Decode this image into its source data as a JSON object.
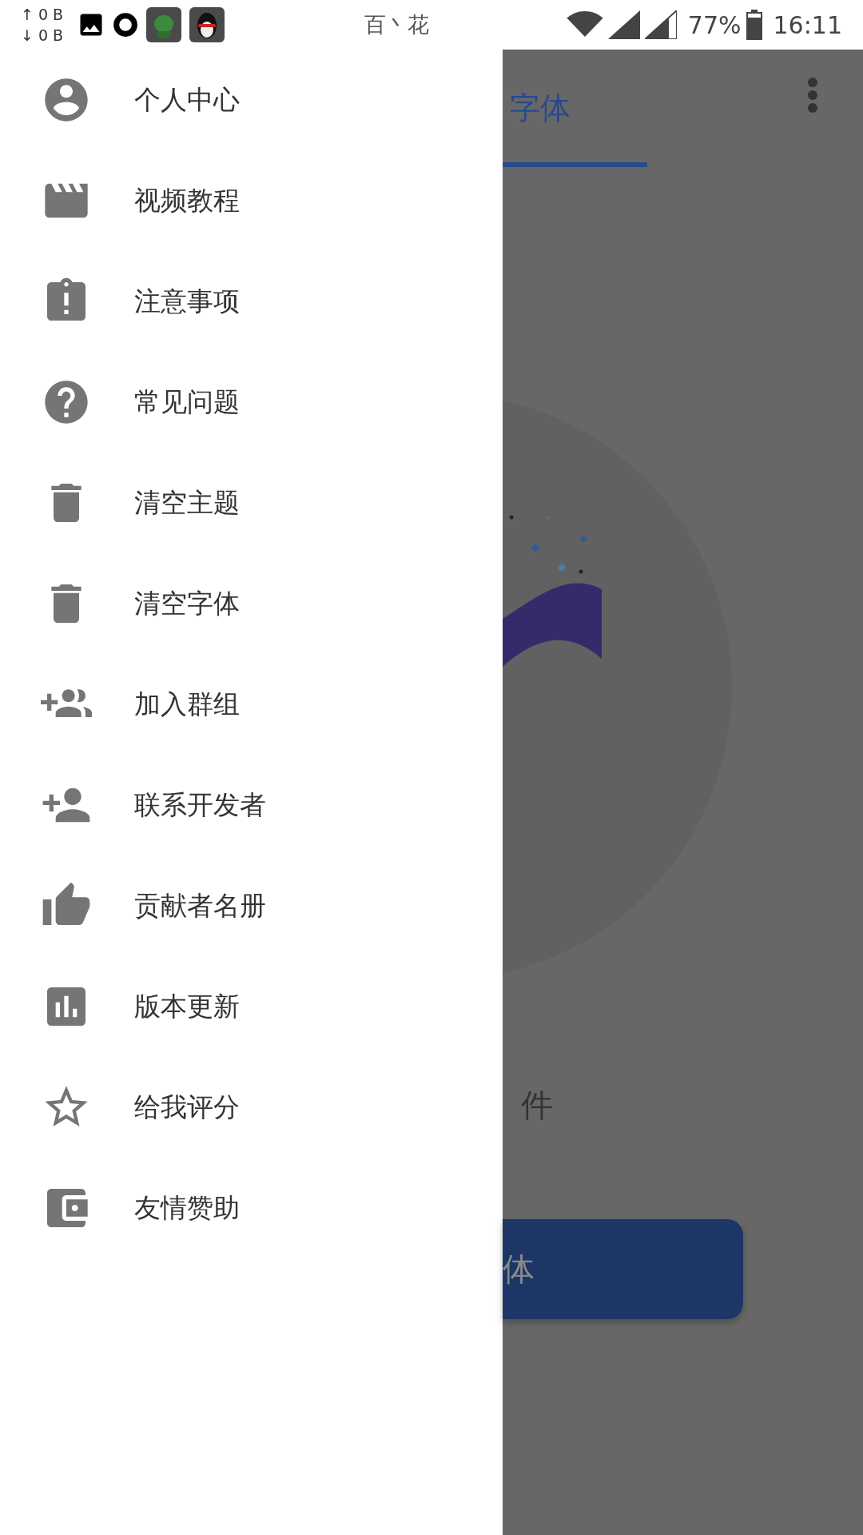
{
  "status_bar": {
    "net_speed": [
      {
        "arrow": "↑",
        "value": "0 B"
      },
      {
        "arrow": "↓",
        "value": "0 B"
      }
    ],
    "carrier": "百丶花",
    "battery": "77%",
    "time": "16:11"
  },
  "drawer": {
    "items": [
      {
        "label": "个人中心"
      },
      {
        "label": "视频教程"
      },
      {
        "label": "注意事项"
      },
      {
        "label": "常见问题"
      },
      {
        "label": "清空主题"
      },
      {
        "label": "清空字体"
      },
      {
        "label": "加入群组"
      },
      {
        "label": "联系开发者"
      },
      {
        "label": "贡献者名册"
      },
      {
        "label": "版本更新"
      },
      {
        "label": "给我评分"
      },
      {
        "label": "友情赞助"
      }
    ]
  },
  "screen": {
    "tab": {
      "label": "字体",
      "selected": true
    },
    "caption": "件",
    "button": "体"
  }
}
